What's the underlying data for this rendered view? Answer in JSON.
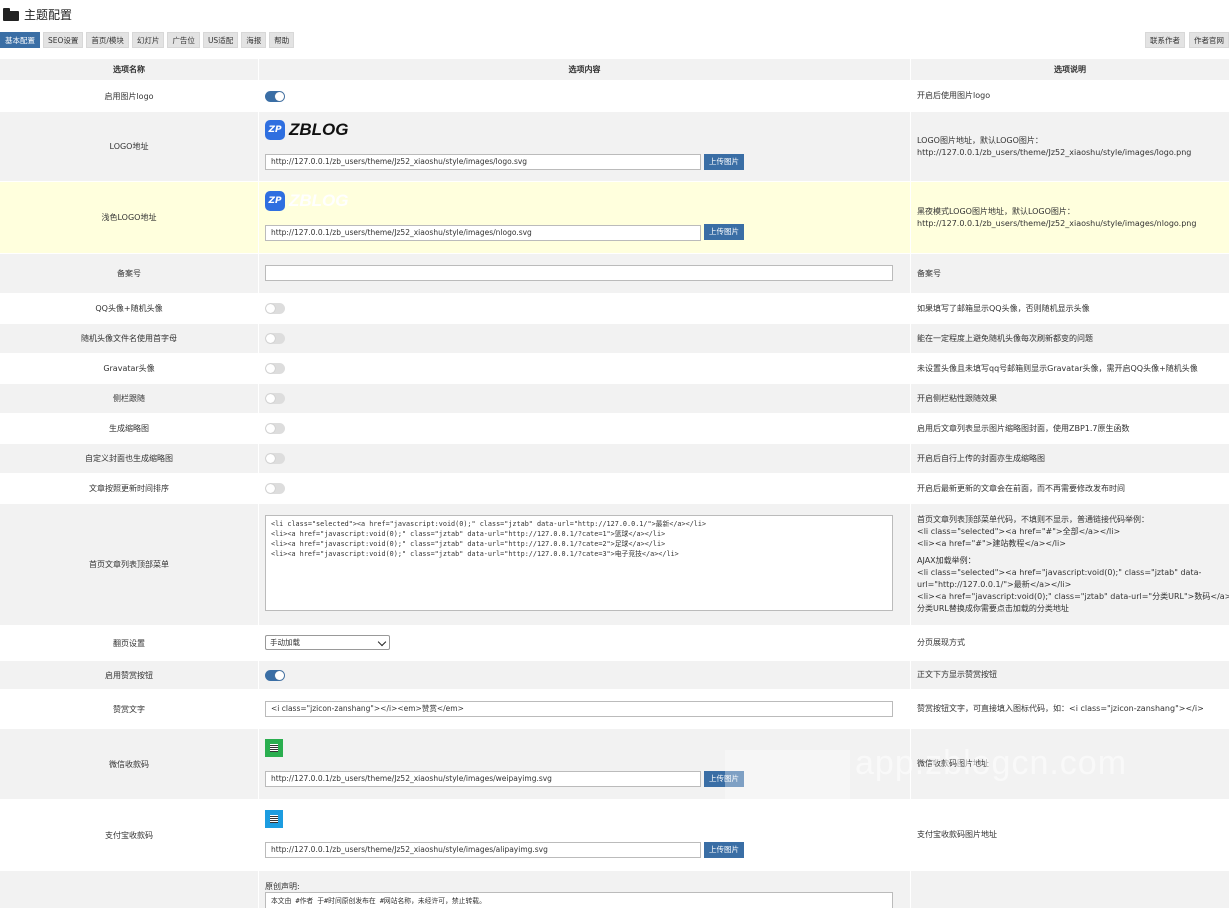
{
  "page": {
    "title": "主题配置"
  },
  "tabs": [
    {
      "label": "基本配置",
      "active": true
    },
    {
      "label": "SEO设置"
    },
    {
      "label": "首页/模块"
    },
    {
      "label": "幻灯片"
    },
    {
      "label": "广告位"
    },
    {
      "label": "US适配"
    },
    {
      "label": "海报"
    },
    {
      "label": "帮助"
    }
  ],
  "right_buttons": {
    "contact": "联系作者",
    "site": "作者官网"
  },
  "table_head": {
    "name": "选项名称",
    "content": "选项内容",
    "desc": "选项说明"
  },
  "rows": {
    "logo_enable": {
      "name": "启用图片logo",
      "on": true,
      "desc": "开启后使用图片logo"
    },
    "logo_url": {
      "name": "LOGO地址",
      "logo_badge": "ZP",
      "logo_text": "ZBLOG",
      "value": "http://127.0.0.1/zb_users/theme/Jz52_xiaoshu/style/images/logo.svg",
      "upload": "上传图片",
      "desc1": "LOGO图片地址，默认LOGO图片：",
      "desc2": "http://127.0.0.1/zb_users/theme/Jz52_xiaoshu/style/images/logo.png"
    },
    "nlogo_url": {
      "name": "浅色LOGO地址",
      "logo_badge": "ZP",
      "logo_text": "ZBLOG",
      "value": "http://127.0.0.1/zb_users/theme/Jz52_xiaoshu/style/images/nlogo.svg",
      "upload": "上传图片",
      "desc1": "黑夜模式LOGO图片地址，默认LOGO图片：",
      "desc2": "http://127.0.0.1/zb_users/theme/Jz52_xiaoshu/style/images/nlogo.png"
    },
    "beian": {
      "name": "备案号",
      "value": "",
      "desc": "备案号"
    },
    "qq_avatar": {
      "name": "QQ头像+随机头像",
      "on": false,
      "desc": "如果填写了邮箱显示QQ头像，否则随机显示头像"
    },
    "random_avatar": {
      "name": "随机头像文件名使用首字母",
      "on": false,
      "desc": "能在一定程度上避免随机头像每次刷新都变的问题"
    },
    "gravatar": {
      "name": "Gravatar头像",
      "on": false,
      "desc": "未设置头像且未填写qq号邮箱则显示Gravatar头像，需开启QQ头像+随机头像"
    },
    "sidebar_follow": {
      "name": "侧栏跟随",
      "on": false,
      "desc": "开启侧栏粘性跟随效果"
    },
    "thumbnail": {
      "name": "生成缩略图",
      "on": false,
      "desc": "启用后文章列表显示图片缩略图封面，使用ZBP1.7原生函数"
    },
    "custom_cover": {
      "name": "自定义封面也生成缩略图",
      "on": false,
      "desc": "开启后自行上传的封面亦生成缩略图"
    },
    "sort_update": {
      "name": "文章按照更新时间排序",
      "on": false,
      "desc": "开启后最新更新的文章会在前面，而不再需要修改发布时间"
    },
    "home_menu": {
      "name": "首页文章列表顶部菜单",
      "code": "<li class=\"selected\"><a href=\"javascript:void(0);\" class=\"jztab\" data-url=\"http://127.0.0.1/\">最新</a></li>\n<li><a href=\"javascript:void(0);\" class=\"jztab\" data-url=\"http://127.0.0.1/?cate=1\">篮球</a></li>\n<li><a href=\"javascript:void(0);\" class=\"jztab\" data-url=\"http://127.0.0.1/?cate=2\">足球</a></li>\n<li><a href=\"javascript:void(0);\" class=\"jztab\" data-url=\"http://127.0.0.1/?cate=3\">电子竞技</a></li>",
      "d1": "首页文章列表顶部菜单代码，不填则不显示，普通链接代码举例：",
      "d2": "<li class=\"selected\"><a href=\"#\">全部</a></li>",
      "d3": "<li><a href=\"#\">建站教程</a></li>",
      "d4": "AJAX加载举例：",
      "d5": "<li class=\"selected\"><a href=\"javascript:void(0);\" class=\"jztab\" data-",
      "d6": "url=\"http://127.0.0.1/\">最新</a></li>",
      "d7": "<li><a href=\"javascript:void(0);\" class=\"jztab\" data-url=\"分类URL\">数码</a></li>",
      "d8": "分类URL替换成你需要点击加载的分类地址"
    },
    "pagination": {
      "name": "翻页设置",
      "selected": "手动加载",
      "desc": "分页展现方式"
    },
    "reward_enable": {
      "name": "启用赞赏按钮",
      "on": true,
      "desc": "正文下方显示赞赏按钮"
    },
    "reward_text": {
      "name": "赞赏文字",
      "value": "<i class=\"jzicon-zanshang\"></i><em>赞赏</em>",
      "desc": "赞赏按钮文字，可直接填入图标代码，如：<i class=\"jzicon-zanshang\"></i>"
    },
    "wechat_qr": {
      "name": "微信收款码",
      "value": "http://127.0.0.1/zb_users/theme/Jz52_xiaoshu/style/images/weipayimg.svg",
      "upload": "上传图片",
      "desc": "微信收款码图片地址"
    },
    "alipay_qr": {
      "name": "支付宝收款码",
      "value": "http://127.0.0.1/zb_users/theme/Jz52_xiaoshu/style/images/alipayimg.svg",
      "upload": "上传图片",
      "desc": "支付宝收款码图片地址"
    },
    "copyright": {
      "label": "原创声明:",
      "value": "本文由 #作者 于#时间原创发布在 #网站名称，未经许可，禁止转载。"
    }
  },
  "watermark": "app.zblogcn.com",
  "colors": {
    "accent": "#3a6ea5",
    "row_alt": "#f2f2f2",
    "highlight": "#ffffdd"
  }
}
